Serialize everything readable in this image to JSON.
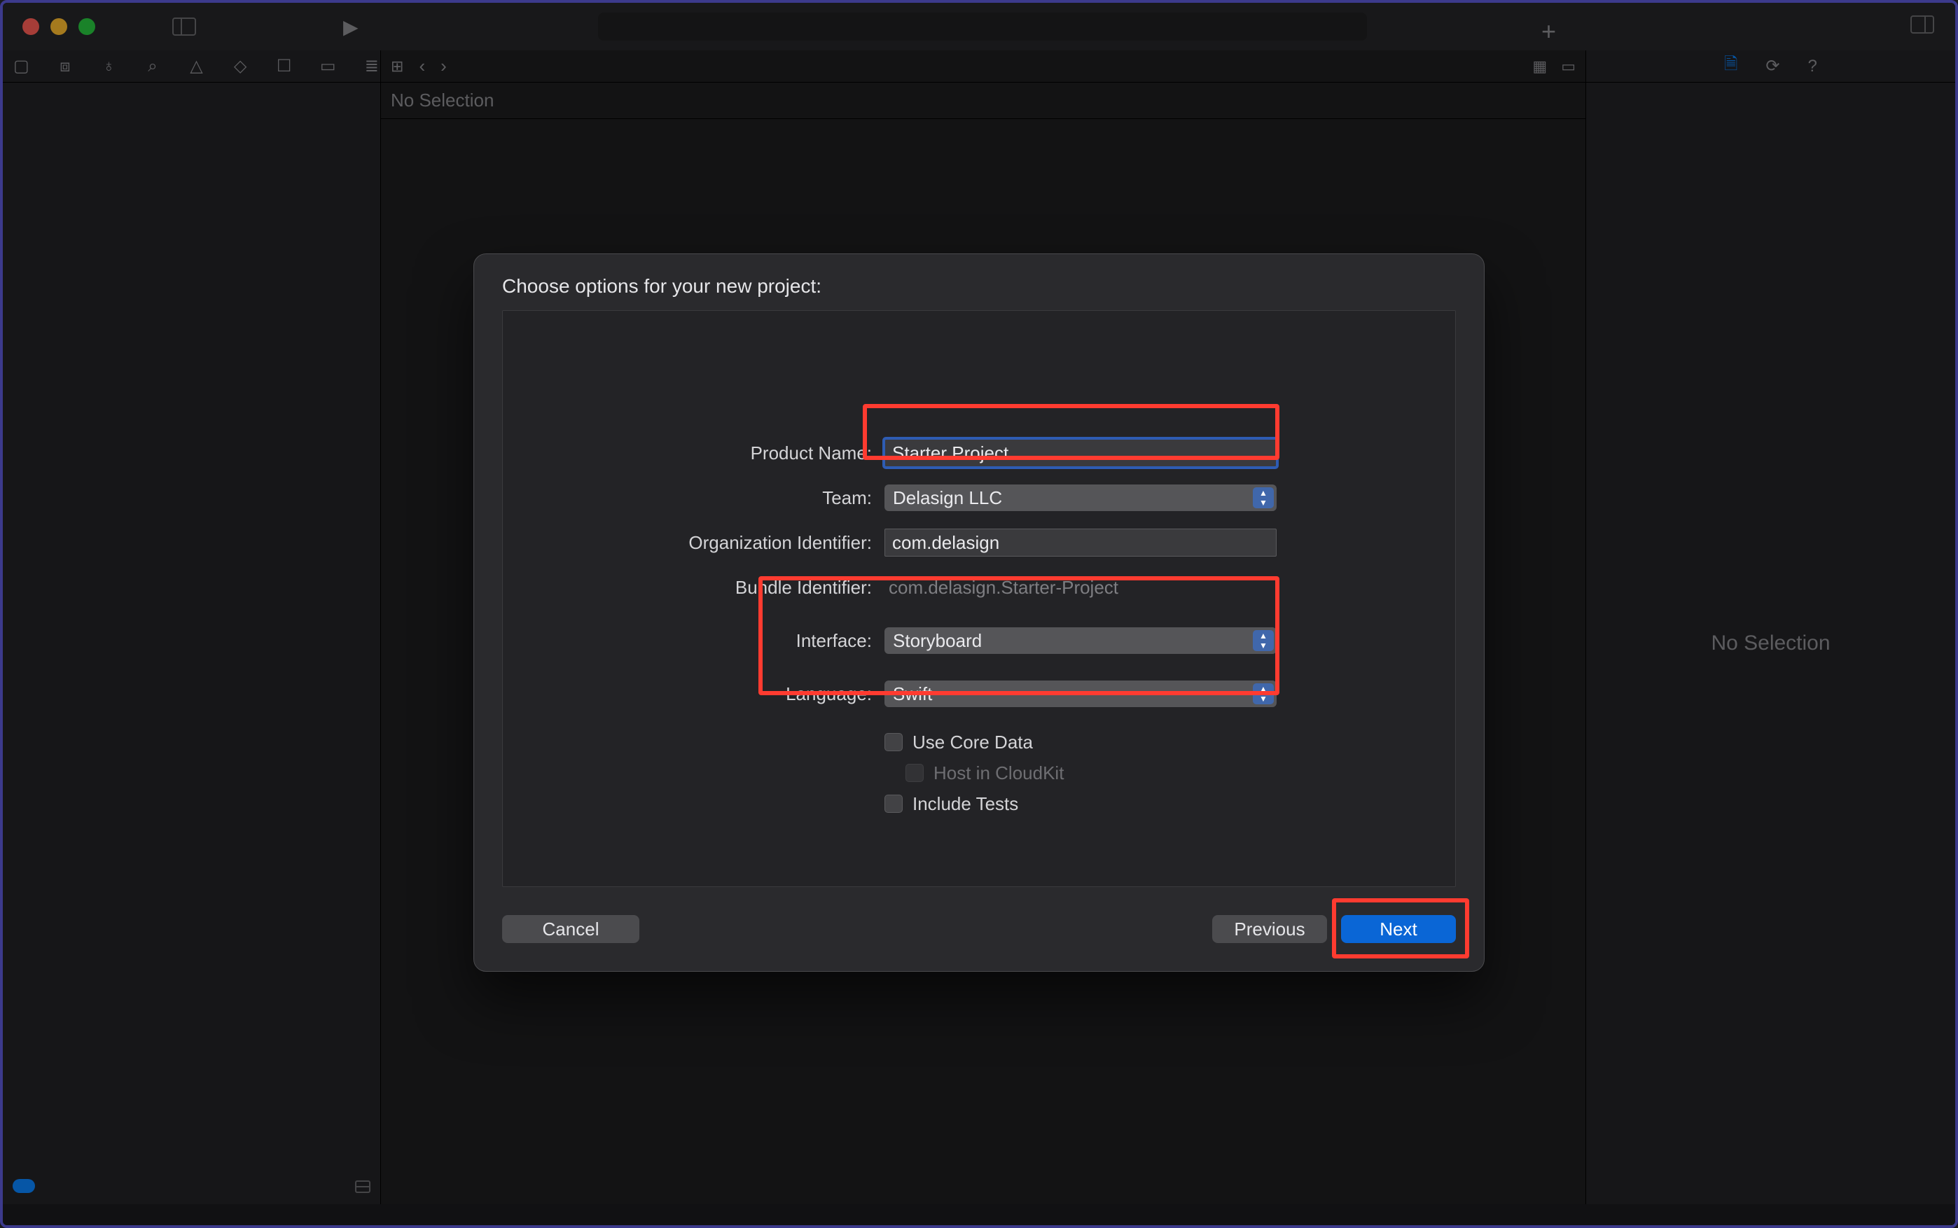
{
  "titlebar": {
    "traffic": [
      "close",
      "minimize",
      "zoom"
    ],
    "run_icon": "▶",
    "add_icon": "+"
  },
  "navigator": {
    "icons": [
      "folder-icon",
      "scm-icon",
      "symbol-icon",
      "find-icon",
      "issues-icon",
      "tests-icon",
      "debug-icon",
      "breakpoints-icon",
      "reports-icon"
    ]
  },
  "editor": {
    "crumb": "No Selection",
    "toolbar_left": [
      "related-items-icon",
      "nav-back-icon",
      "nav-forward-icon"
    ],
    "toolbar_right": [
      "minimap-icon",
      "editor-options-icon"
    ]
  },
  "inspector": {
    "tabs": [
      "file-inspector-icon",
      "history-inspector-icon",
      "help-inspector-icon"
    ],
    "body": "No Selection"
  },
  "sheet": {
    "title": "Choose options for your new project:",
    "labels": {
      "product_name": "Product Name:",
      "team": "Team:",
      "org_id": "Organization Identifier:",
      "bundle_id": "Bundle Identifier:",
      "interface": "Interface:",
      "language": "Language:"
    },
    "values": {
      "product_name": "Starter Project",
      "team": "Delasign LLC",
      "org_id": "com.delasign",
      "bundle_id": "com.delasign.Starter-Project",
      "interface": "Storyboard",
      "language": "Swift"
    },
    "checkboxes": {
      "core_data": "Use Core Data",
      "cloudkit": "Host in CloudKit",
      "tests": "Include Tests"
    },
    "buttons": {
      "cancel": "Cancel",
      "previous": "Previous",
      "next": "Next"
    }
  }
}
